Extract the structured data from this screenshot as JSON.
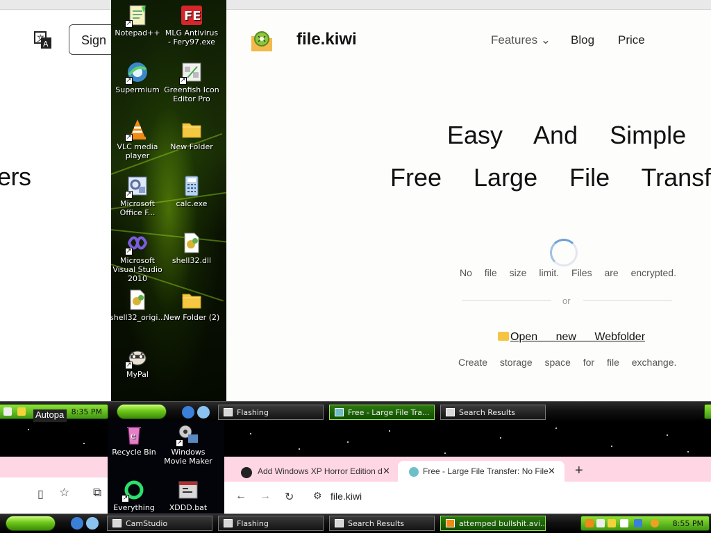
{
  "left_page": {
    "sign_label": "Sign",
    "heading_fragment": "ers"
  },
  "desktop_icons_top": [
    {
      "label": "Notepad++",
      "icon": "notepadpp-icon"
    },
    {
      "label": "MLG Antivirus - Fery97.exe",
      "icon": "antivirus-icon"
    },
    {
      "label": "Supermium",
      "icon": "supermium-icon"
    },
    {
      "label": "Greenfish Icon Editor Pro",
      "icon": "greenfish-icon"
    },
    {
      "label": "VLC media player",
      "icon": "vlc-icon"
    },
    {
      "label": "New Folder",
      "icon": "folder-icon"
    },
    {
      "label": "Microsoft Office F...",
      "icon": "office-icon"
    },
    {
      "label": "calc.exe",
      "icon": "calculator-icon"
    },
    {
      "label": "Microsoft Visual Studio 2010",
      "icon": "visual-studio-icon"
    },
    {
      "label": "shell32.dll",
      "icon": "dll-icon"
    },
    {
      "label": "shell32_origi...",
      "icon": "dll-icon"
    },
    {
      "label": "New Folder (2)",
      "icon": "folder-icon"
    },
    {
      "label": "MyPal",
      "icon": "mypal-icon"
    }
  ],
  "kiwi": {
    "brand": "file.kiwi",
    "nav": {
      "features": "Features ⌄",
      "blog": "Blog",
      "price": "Price"
    },
    "hero_line1": "Easy And Simple",
    "hero_line2": "Free Large File Transfe",
    "tagline": "No file size limit. Files are encrypted.",
    "or": "or",
    "open_link": "Open new Webfolder",
    "create_text": "Create storage space for file exchange."
  },
  "taskbar_upper": {
    "left_clock": "8:35 PM",
    "autopa": "Autopa",
    "buttons": [
      {
        "label": "Flashing",
        "active": false
      },
      {
        "label": "Free - Large File Tra...",
        "active": true
      },
      {
        "label": "Search Results",
        "active": false
      }
    ]
  },
  "desktop_icons_bottom": [
    {
      "label": "Recycle Bin",
      "icon": "recycle-bin-icon"
    },
    {
      "label": "Windows Movie Maker",
      "icon": "movie-maker-icon"
    },
    {
      "label": "Everything",
      "icon": "everything-icon"
    },
    {
      "label": "XDDD.bat",
      "icon": "bat-file-icon"
    }
  ],
  "chrome": {
    "tab1": "Add Windows XP Horror Edition d",
    "tab2": "Free - Large File Transfer: No File",
    "url": "file.kiwi"
  },
  "taskbar_lower": {
    "buttons": [
      {
        "label": "CamStudio",
        "active": false
      },
      {
        "label": "Flashing",
        "active": false
      },
      {
        "label": "Search Results",
        "active": false
      },
      {
        "label": "attemped bullshit.avi...",
        "active": true
      }
    ],
    "clock": "8:55 PM"
  },
  "colors": {
    "xp_green": "#6ec61a",
    "chrome_pink": "#ffd6e4",
    "page_bg": "#fdfdfb"
  }
}
